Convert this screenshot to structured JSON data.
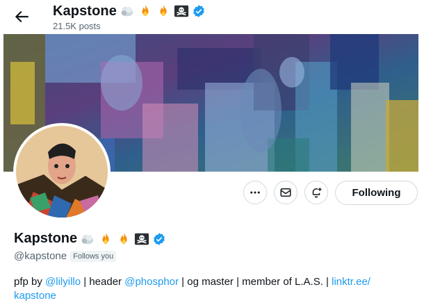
{
  "header": {
    "title": "Kapstone",
    "post_count": "21.5K posts",
    "emojis": [
      "cloud-icon",
      "fire-icon",
      "fire-icon",
      "skull-crossbones-icon"
    ],
    "verified_color": "#1d9bf0"
  },
  "profile": {
    "display_name": "Kapstone",
    "handle": "@kapstone",
    "follows_you": "Follows you",
    "bio": {
      "t1": "pfp by ",
      "m1": "@lilyillo",
      "t2": " | header ",
      "m2": "@phosphor",
      "t3": " | og master | member of L.A.S. | ",
      "link": "linktr.ee/ kapstone"
    }
  },
  "actions": {
    "more_icon": "more-icon",
    "message_icon": "envelope-icon",
    "notify_icon": "bell-plus-icon",
    "following_label": "Following"
  },
  "colors": {
    "accent": "#1d9bf0",
    "text": "#0f1419",
    "secondary": "#536471"
  }
}
